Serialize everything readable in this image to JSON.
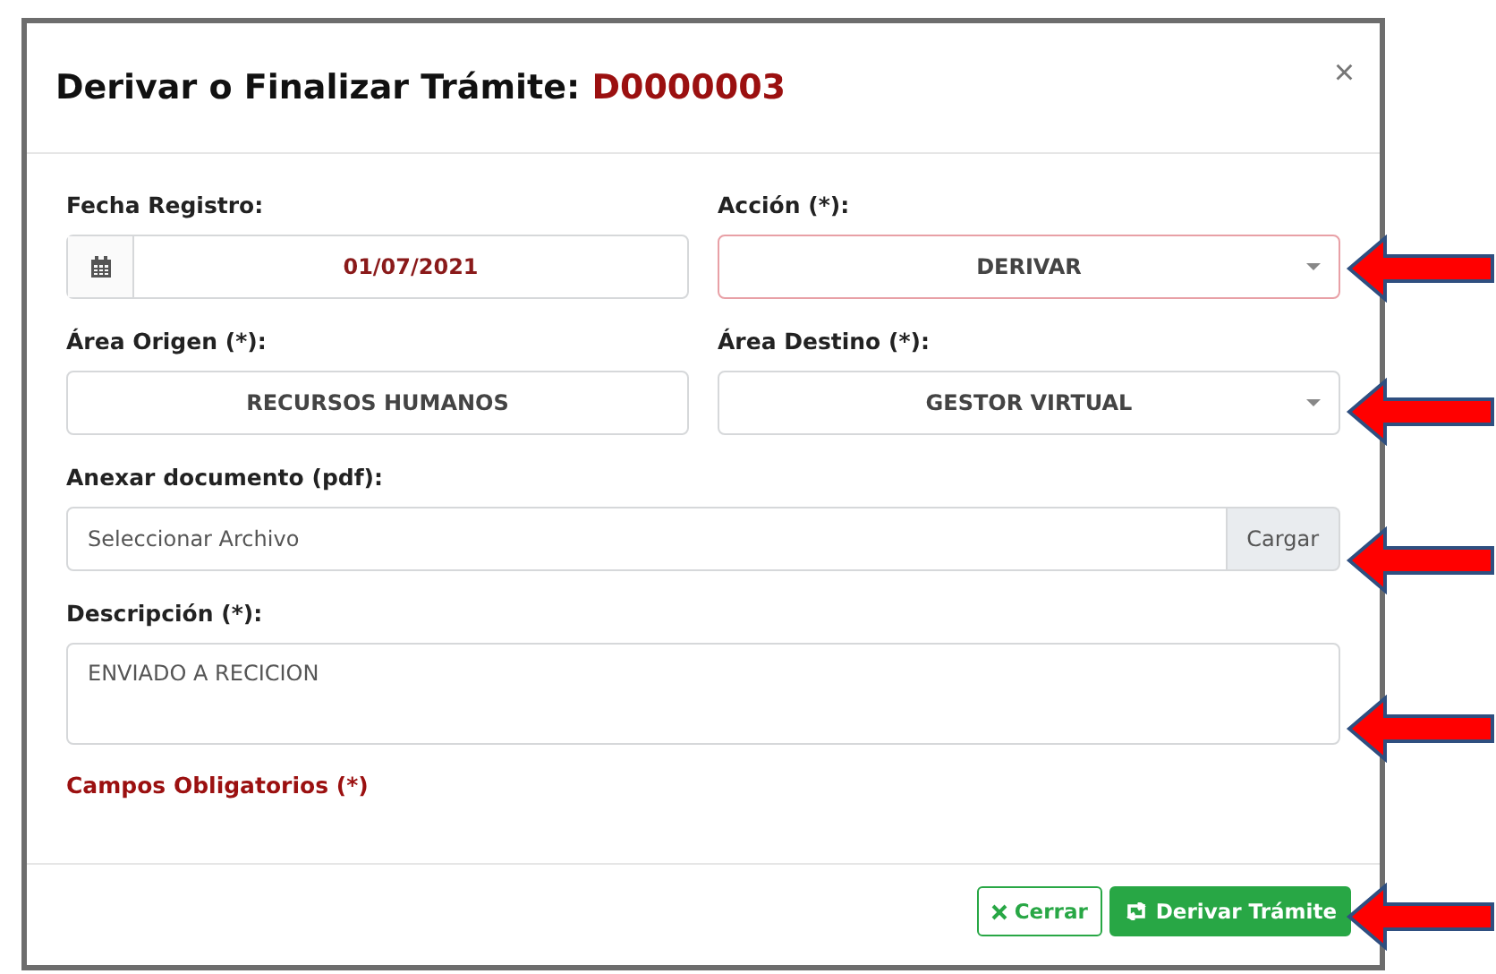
{
  "modal": {
    "title": "Derivar o Finalizar Trámite:",
    "code": "D0000003",
    "close": "×"
  },
  "fields": [
    {
      "kind": "date",
      "label": "Fecha Registro:",
      "value": "01/07/2021"
    },
    {
      "kind": "select",
      "label": "Acción (*):",
      "value": "DERIVAR",
      "invalid": true
    },
    {
      "kind": "text",
      "label": "Área Origen (*):",
      "value": "RECURSOS HUMANOS"
    },
    {
      "kind": "select",
      "label": "Área Destino (*):",
      "value": "GESTOR VIRTUAL",
      "invalid": false
    },
    {
      "kind": "file",
      "label": "Anexar documento (pdf):",
      "placeholder": "Seleccionar Archivo",
      "button": "Cargar"
    },
    {
      "kind": "textarea",
      "label": "Descripción (*):",
      "value": "ENVIADO A RECICION"
    }
  ],
  "required_note": "Campos Obligatorios (*)",
  "buttons": [
    {
      "kind": "outline",
      "label": "Cerrar"
    },
    {
      "kind": "solid",
      "label": "Derivar Trámite"
    }
  ]
}
